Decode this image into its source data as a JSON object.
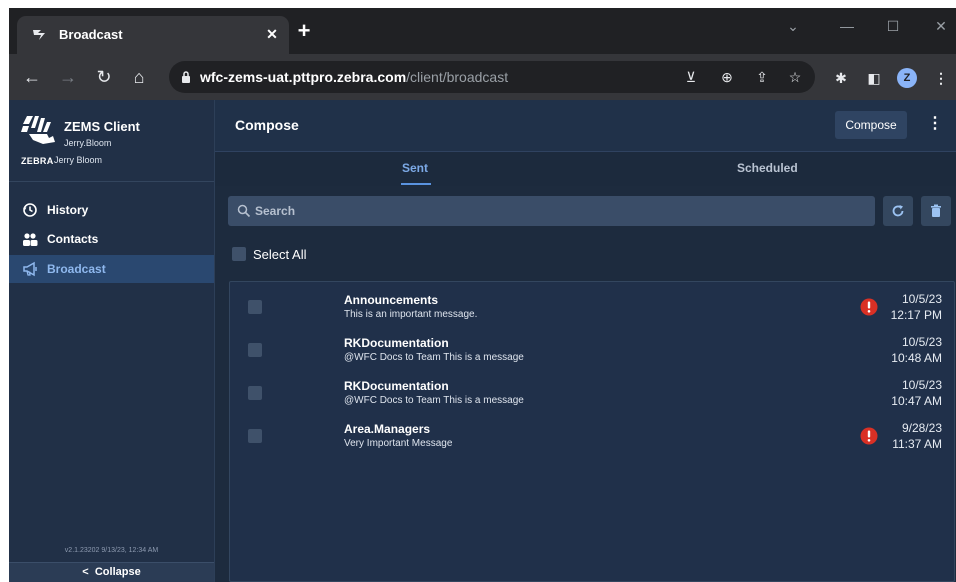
{
  "browser": {
    "tab_title": "Broadcast",
    "new_tab": "+",
    "url_host": "wfc-zems-uat.pttpro.zebra.com",
    "url_path": "/client/broadcast",
    "profile_initial": "Z"
  },
  "sidebar": {
    "app_name": "ZEMS Client",
    "brand_word": "ZEBRA",
    "username": "Jerry.Bloom",
    "display_name": "Jerry Bloom",
    "items": [
      {
        "label": "History",
        "icon": "history-icon",
        "active": false
      },
      {
        "label": "Contacts",
        "icon": "contacts-icon",
        "active": false
      },
      {
        "label": "Broadcast",
        "icon": "megaphone-icon",
        "active": true
      }
    ],
    "version": "v2.1.23202 9/13/23, 12:34 AM",
    "collapse_label": "Collapse",
    "collapse_chevron": "<"
  },
  "header": {
    "title": "Compose",
    "compose_button": "Compose"
  },
  "tabs": {
    "sent": "Sent",
    "scheduled": "Scheduled"
  },
  "search": {
    "placeholder": "Search"
  },
  "select_all": "Select All",
  "messages": [
    {
      "sender": "Announcements",
      "text": "This is an important message.",
      "date": "10/5/23",
      "time": "12:17 PM",
      "important": true
    },
    {
      "sender": "RKDocumentation",
      "text": "@WFC Docs to Team This is a message",
      "date": "10/5/23",
      "time": "10:48 AM",
      "important": false
    },
    {
      "sender": "RKDocumentation",
      "text": "@WFC Docs to Team This is a message",
      "date": "10/5/23",
      "time": "10:47 AM",
      "important": false
    },
    {
      "sender": "Area.Managers",
      "text": "Very Important Message",
      "date": "9/28/23",
      "time": "11:37 AM",
      "important": true
    }
  ],
  "colors": {
    "accent": "#5a93e0",
    "alert": "#d93025",
    "sidebar_active": "#2a4870"
  }
}
